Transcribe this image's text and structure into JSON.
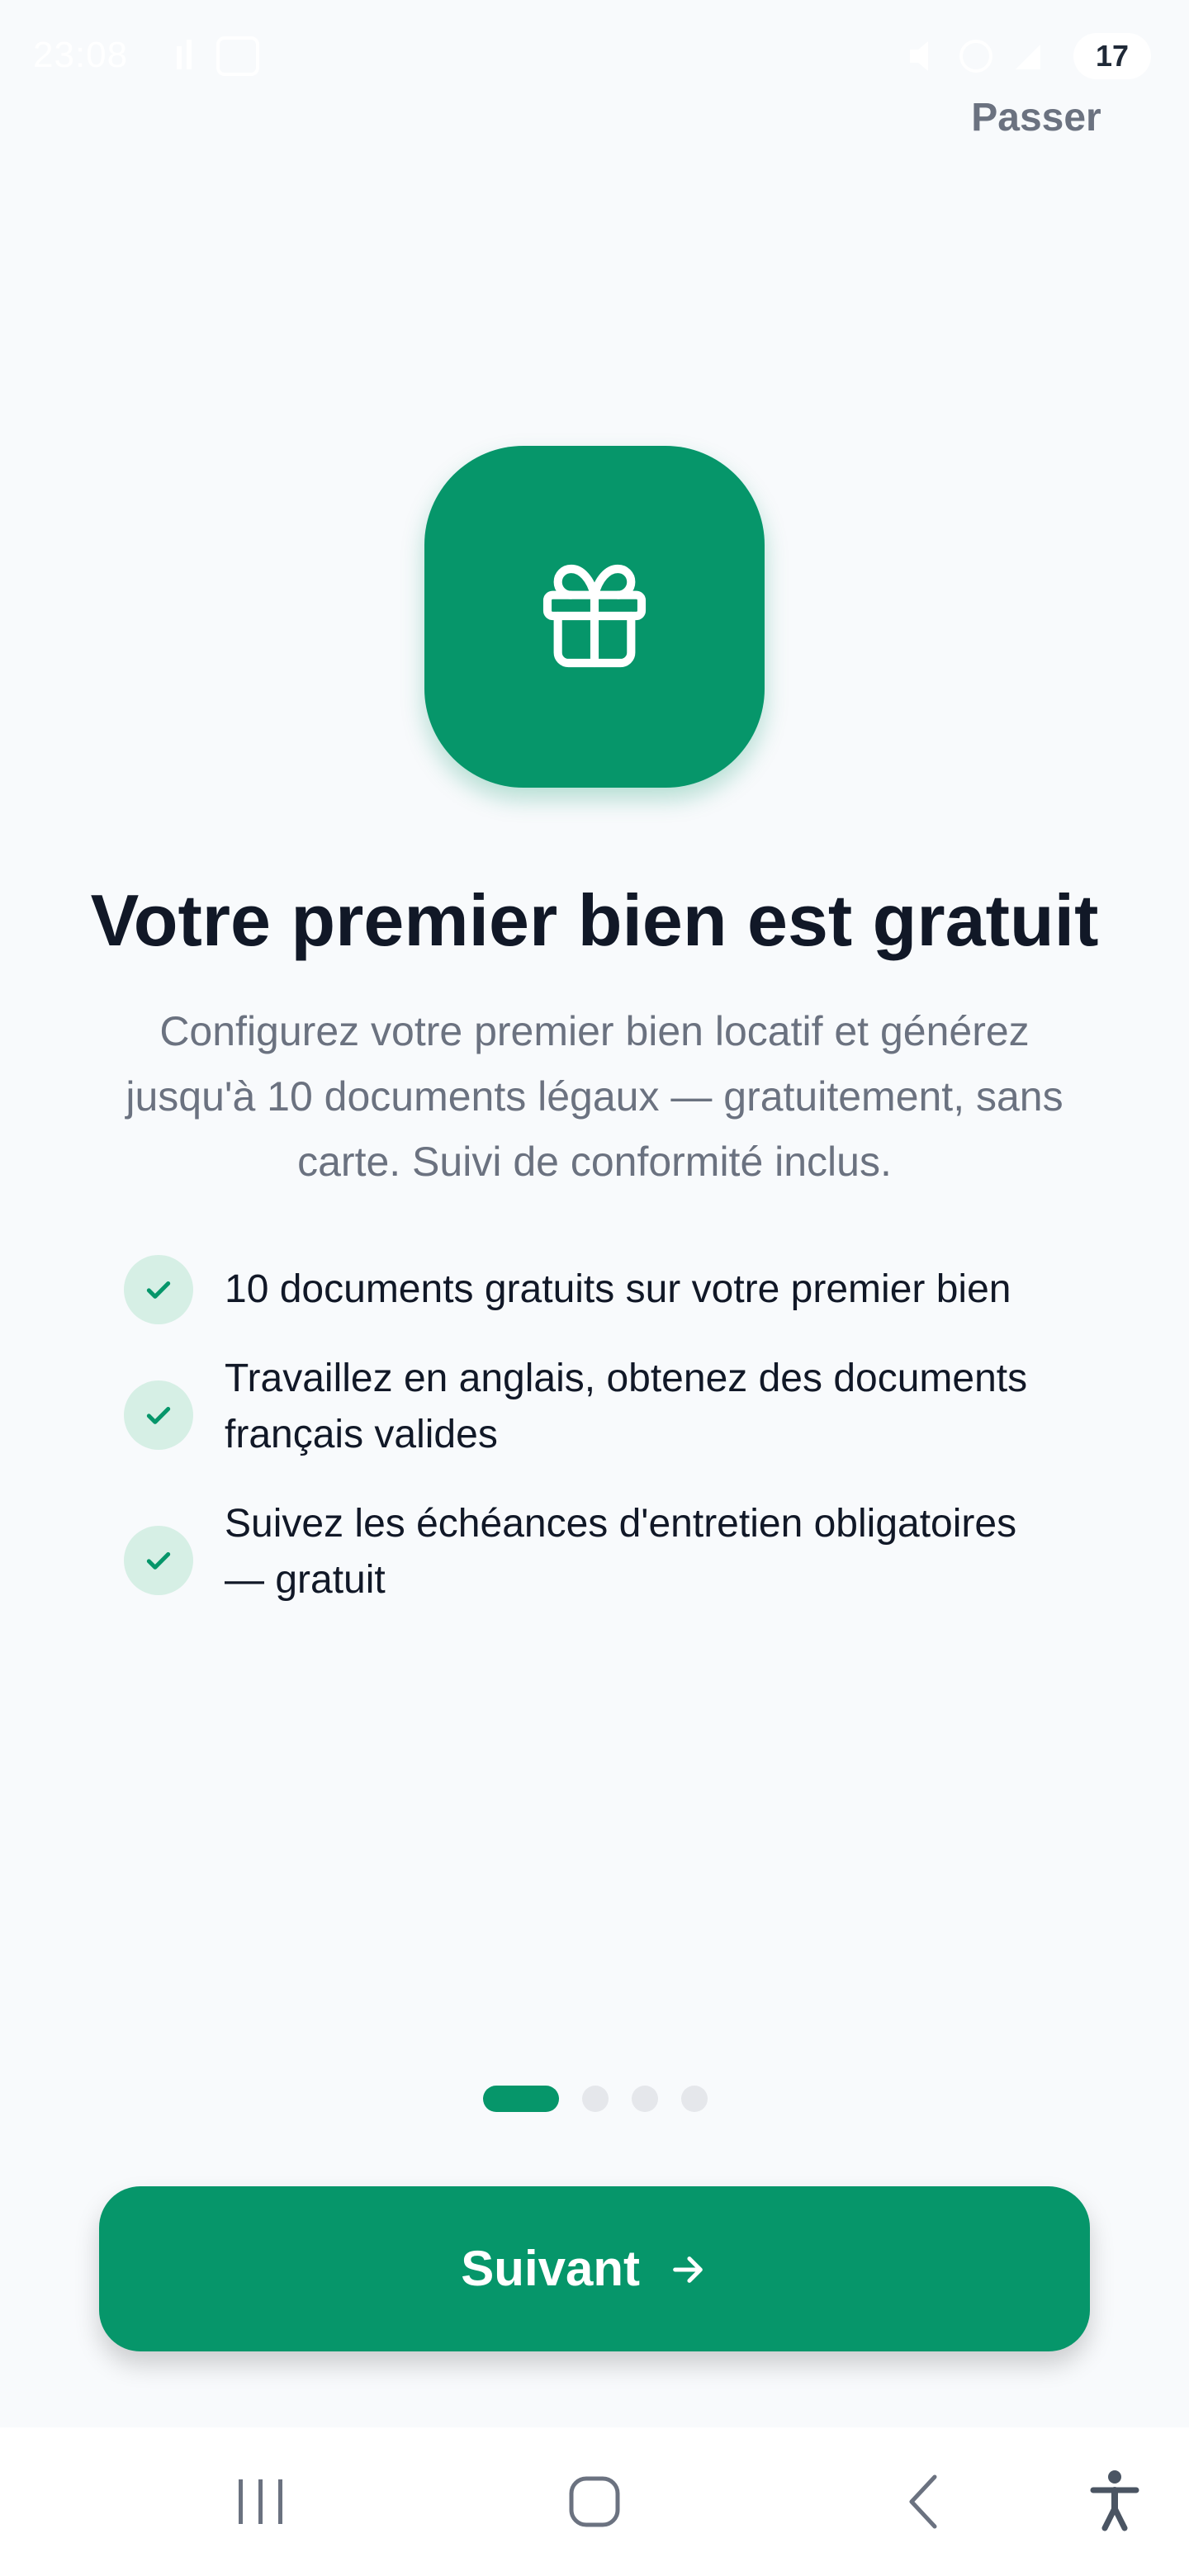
{
  "status_bar": {
    "time": "23:08",
    "battery": "17"
  },
  "header": {
    "skip_label": "Passer"
  },
  "hero": {
    "icon": "gift-icon",
    "accent_color": "#06966a"
  },
  "content": {
    "title": "Votre premier bien est gratuit",
    "description": "Configurez votre premier bien locatif et générez jusqu'à 10 documents légaux — gratuitement, sans carte. Suivi de conformité inclus.",
    "features": [
      {
        "icon": "check-icon",
        "text": "10 documents gratuits sur votre premier bien"
      },
      {
        "icon": "check-icon",
        "text": "Travaillez en anglais, obtenez des documents français valides"
      },
      {
        "icon": "check-icon",
        "text": "Suivez les échéances d'entretien obligatoires — gratuit"
      }
    ]
  },
  "pager": {
    "current_page": 1,
    "total_pages": 4
  },
  "footer": {
    "next_label": "Suivant",
    "next_icon": "arrow-right-icon"
  },
  "nav_bar": {
    "recents_icon": "recents-icon",
    "home_icon": "home-icon",
    "back_icon": "back-icon",
    "accessibility_icon": "accessibility-icon"
  }
}
